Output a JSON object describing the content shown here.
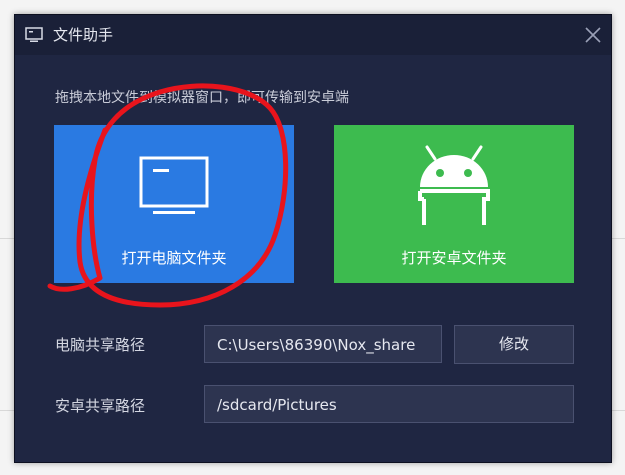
{
  "window": {
    "title": "文件助手",
    "title_icon": "monitor-icon",
    "close_icon": "close-icon"
  },
  "hint_text": "拖拽本地文件到模拟器窗口，即可传输到安卓端",
  "cards": {
    "pc": {
      "label": "打开电脑文件夹",
      "icon": "monitor-icon",
      "color": "#2a7ae2"
    },
    "android": {
      "label": "打开安卓文件夹",
      "icon": "android-icon",
      "color": "#3dbb4f"
    }
  },
  "pc_share": {
    "label": "电脑共享路径",
    "value": "C:\\Users\\86390\\Nox_share",
    "button": "修改"
  },
  "android_share": {
    "label": "安卓共享路径",
    "value": "/sdcard/Pictures"
  },
  "colors": {
    "dialog_bg": "#1f2642",
    "annotation": "#e8141c"
  }
}
